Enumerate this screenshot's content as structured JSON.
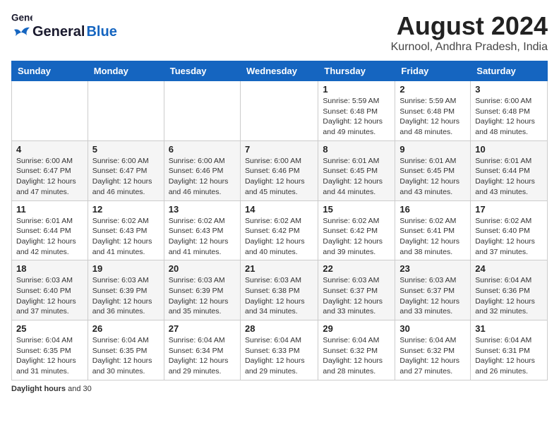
{
  "header": {
    "logo_general": "General",
    "logo_blue": "Blue",
    "month": "August 2024",
    "location": "Kurnool, Andhra Pradesh, India"
  },
  "weekdays": [
    "Sunday",
    "Monday",
    "Tuesday",
    "Wednesday",
    "Thursday",
    "Friday",
    "Saturday"
  ],
  "weeks": [
    [
      {
        "day": "",
        "info": ""
      },
      {
        "day": "",
        "info": ""
      },
      {
        "day": "",
        "info": ""
      },
      {
        "day": "",
        "info": ""
      },
      {
        "day": "1",
        "info": "Sunrise: 5:59 AM\nSunset: 6:48 PM\nDaylight: 12 hours and 49 minutes."
      },
      {
        "day": "2",
        "info": "Sunrise: 5:59 AM\nSunset: 6:48 PM\nDaylight: 12 hours and 48 minutes."
      },
      {
        "day": "3",
        "info": "Sunrise: 6:00 AM\nSunset: 6:48 PM\nDaylight: 12 hours and 48 minutes."
      }
    ],
    [
      {
        "day": "4",
        "info": "Sunrise: 6:00 AM\nSunset: 6:47 PM\nDaylight: 12 hours and 47 minutes."
      },
      {
        "day": "5",
        "info": "Sunrise: 6:00 AM\nSunset: 6:47 PM\nDaylight: 12 hours and 46 minutes."
      },
      {
        "day": "6",
        "info": "Sunrise: 6:00 AM\nSunset: 6:46 PM\nDaylight: 12 hours and 46 minutes."
      },
      {
        "day": "7",
        "info": "Sunrise: 6:00 AM\nSunset: 6:46 PM\nDaylight: 12 hours and 45 minutes."
      },
      {
        "day": "8",
        "info": "Sunrise: 6:01 AM\nSunset: 6:45 PM\nDaylight: 12 hours and 44 minutes."
      },
      {
        "day": "9",
        "info": "Sunrise: 6:01 AM\nSunset: 6:45 PM\nDaylight: 12 hours and 43 minutes."
      },
      {
        "day": "10",
        "info": "Sunrise: 6:01 AM\nSunset: 6:44 PM\nDaylight: 12 hours and 43 minutes."
      }
    ],
    [
      {
        "day": "11",
        "info": "Sunrise: 6:01 AM\nSunset: 6:44 PM\nDaylight: 12 hours and 42 minutes."
      },
      {
        "day": "12",
        "info": "Sunrise: 6:02 AM\nSunset: 6:43 PM\nDaylight: 12 hours and 41 minutes."
      },
      {
        "day": "13",
        "info": "Sunrise: 6:02 AM\nSunset: 6:43 PM\nDaylight: 12 hours and 41 minutes."
      },
      {
        "day": "14",
        "info": "Sunrise: 6:02 AM\nSunset: 6:42 PM\nDaylight: 12 hours and 40 minutes."
      },
      {
        "day": "15",
        "info": "Sunrise: 6:02 AM\nSunset: 6:42 PM\nDaylight: 12 hours and 39 minutes."
      },
      {
        "day": "16",
        "info": "Sunrise: 6:02 AM\nSunset: 6:41 PM\nDaylight: 12 hours and 38 minutes."
      },
      {
        "day": "17",
        "info": "Sunrise: 6:02 AM\nSunset: 6:40 PM\nDaylight: 12 hours and 37 minutes."
      }
    ],
    [
      {
        "day": "18",
        "info": "Sunrise: 6:03 AM\nSunset: 6:40 PM\nDaylight: 12 hours and 37 minutes."
      },
      {
        "day": "19",
        "info": "Sunrise: 6:03 AM\nSunset: 6:39 PM\nDaylight: 12 hours and 36 minutes."
      },
      {
        "day": "20",
        "info": "Sunrise: 6:03 AM\nSunset: 6:39 PM\nDaylight: 12 hours and 35 minutes."
      },
      {
        "day": "21",
        "info": "Sunrise: 6:03 AM\nSunset: 6:38 PM\nDaylight: 12 hours and 34 minutes."
      },
      {
        "day": "22",
        "info": "Sunrise: 6:03 AM\nSunset: 6:37 PM\nDaylight: 12 hours and 33 minutes."
      },
      {
        "day": "23",
        "info": "Sunrise: 6:03 AM\nSunset: 6:37 PM\nDaylight: 12 hours and 33 minutes."
      },
      {
        "day": "24",
        "info": "Sunrise: 6:04 AM\nSunset: 6:36 PM\nDaylight: 12 hours and 32 minutes."
      }
    ],
    [
      {
        "day": "25",
        "info": "Sunrise: 6:04 AM\nSunset: 6:35 PM\nDaylight: 12 hours and 31 minutes."
      },
      {
        "day": "26",
        "info": "Sunrise: 6:04 AM\nSunset: 6:35 PM\nDaylight: 12 hours and 30 minutes."
      },
      {
        "day": "27",
        "info": "Sunrise: 6:04 AM\nSunset: 6:34 PM\nDaylight: 12 hours and 29 minutes."
      },
      {
        "day": "28",
        "info": "Sunrise: 6:04 AM\nSunset: 6:33 PM\nDaylight: 12 hours and 29 minutes."
      },
      {
        "day": "29",
        "info": "Sunrise: 6:04 AM\nSunset: 6:32 PM\nDaylight: 12 hours and 28 minutes."
      },
      {
        "day": "30",
        "info": "Sunrise: 6:04 AM\nSunset: 6:32 PM\nDaylight: 12 hours and 27 minutes."
      },
      {
        "day": "31",
        "info": "Sunrise: 6:04 AM\nSunset: 6:31 PM\nDaylight: 12 hours and 26 minutes."
      }
    ]
  ],
  "footer": {
    "label": "Daylight hours",
    "detail": "and 30"
  }
}
